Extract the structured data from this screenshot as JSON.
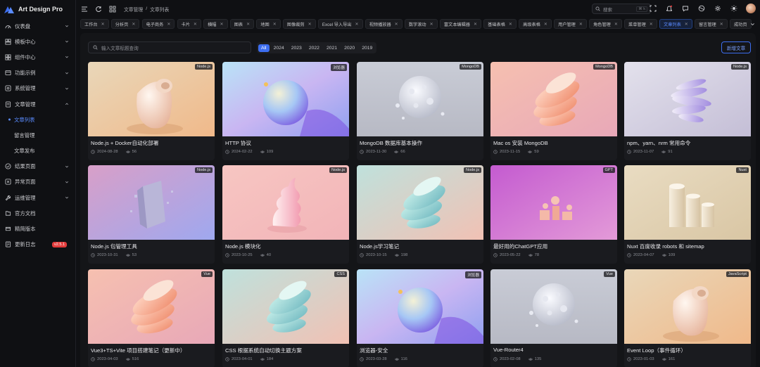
{
  "app": {
    "name": "Art Design Pro"
  },
  "sidebar": {
    "items": [
      {
        "label": "仪表盘",
        "icon": "dashboard-icon",
        "chevron": true
      },
      {
        "label": "模板中心",
        "icon": "template-icon",
        "chevron": true
      },
      {
        "label": "组件中心",
        "icon": "component-icon",
        "chevron": true
      },
      {
        "label": "功能示例",
        "icon": "example-icon",
        "chevron": true
      },
      {
        "label": "系统管理",
        "icon": "system-icon",
        "chevron": true
      },
      {
        "label": "文章管理",
        "icon": "article-icon",
        "chevron": true,
        "expanded": true
      },
      {
        "label": "文章列表",
        "sub": true,
        "active": true
      },
      {
        "label": "留言管理",
        "sub": true
      },
      {
        "label": "文章发布",
        "sub": true
      },
      {
        "label": "结果页面",
        "icon": "result-icon",
        "chevron": true
      },
      {
        "label": "异常页面",
        "icon": "exception-icon",
        "chevron": true
      },
      {
        "label": "运维管理",
        "icon": "ops-icon",
        "chevron": true
      },
      {
        "label": "官方文档",
        "icon": "docs-icon"
      },
      {
        "label": "精简版本",
        "icon": "lite-icon"
      },
      {
        "label": "更新日志",
        "icon": "log-icon",
        "badge": "v2.5.1"
      }
    ]
  },
  "topbar": {
    "breadcrumb": [
      "文章管理",
      "/",
      "文章列表"
    ],
    "search_placeholder": "搜索",
    "search_kbd": "⌘ k"
  },
  "tabs": [
    "工作台",
    "分析页",
    "电子商务",
    "卡片",
    "横幅",
    "图表",
    "地图",
    "图像裁剪",
    "Excel 导入导出",
    "视频播放器",
    "数字滚动",
    "富文本编辑器",
    "基础表格",
    "高级表格",
    "用户管理",
    "角色管理",
    "菜单管理",
    "文章列表",
    "留言管理",
    "成功页"
  ],
  "active_tab": "文章列表",
  "content": {
    "search_placeholder": "输入文章标题查询",
    "years": [
      "All",
      "2024",
      "2023",
      "2022",
      "2021",
      "2020",
      "2019"
    ],
    "active_year": "All",
    "add_button": "新增文章"
  },
  "articles": [
    {
      "title": "Node.js + Docker自动化部署",
      "date": "2024-08-28",
      "views": "56",
      "tag": "Node.js",
      "art": "vase-warm"
    },
    {
      "title": "HTTP 协议",
      "date": "2024-02-22",
      "views": "109",
      "tag": "浏览器",
      "art": "sphere-holo"
    },
    {
      "title": "MongoDB 数据库基本操作",
      "date": "2023-11-30",
      "views": "66",
      "tag": "MongoDB",
      "art": "moon-gray"
    },
    {
      "title": "Mac os 安装 MongoDB",
      "date": "2023-11-15",
      "views": "59",
      "tag": "MongoDB",
      "art": "disks-peach"
    },
    {
      "title": "npm、yarn、nrm 常用命令",
      "date": "2023-11-07",
      "views": "91",
      "tag": "Node.js",
      "art": "twist-purple"
    },
    {
      "title": "Node.js 包管理工具",
      "date": "2023-10-31",
      "views": "53",
      "tag": "Node.js",
      "art": "block-pink"
    },
    {
      "title": "Node.js 模块化",
      "date": "2023-10-25",
      "views": "40",
      "tag": "Node.js",
      "art": "swirl-pink"
    },
    {
      "title": "Node.js学习笔记",
      "date": "2023-10-15",
      "views": "198",
      "tag": "Node.js",
      "art": "disks-teal"
    },
    {
      "title": "最好用的ChatGPT应用",
      "date": "2023-05-22",
      "views": "78",
      "tag": "GPT",
      "art": "blocks-magenta"
    },
    {
      "title": "Nuxt 百度收录 robots 和 sitemap",
      "date": "2023-04-07",
      "views": "109",
      "tag": "Nuxt",
      "art": "cylinders-beige"
    },
    {
      "title": "Vue3+TS+Vite 项目搭建笔记（更新中）",
      "date": "2023-04-03",
      "views": "516",
      "tag": "Vue",
      "art": "disks-peach"
    },
    {
      "title": "CSS 根据系统自动切换主题方案",
      "date": "2023-04-01",
      "views": "184",
      "tag": "CSS",
      "art": "disks-teal"
    },
    {
      "title": "浏览器-安全",
      "date": "2023-03-28",
      "views": "116",
      "tag": "浏览器",
      "art": "sphere-holo"
    },
    {
      "title": "Vue-Router4",
      "date": "2023-02-08",
      "views": "135",
      "tag": "Vue",
      "art": "moon-gray"
    },
    {
      "title": "Event Loop（事件循环）",
      "date": "2023-01-03",
      "views": "161",
      "tag": "JavaScript",
      "art": "vase-warm"
    }
  ],
  "colors": {
    "accent": "#3d6ef0",
    "bg": "#0f1013",
    "panel": "#141518",
    "badge": "#e23b3b"
  }
}
